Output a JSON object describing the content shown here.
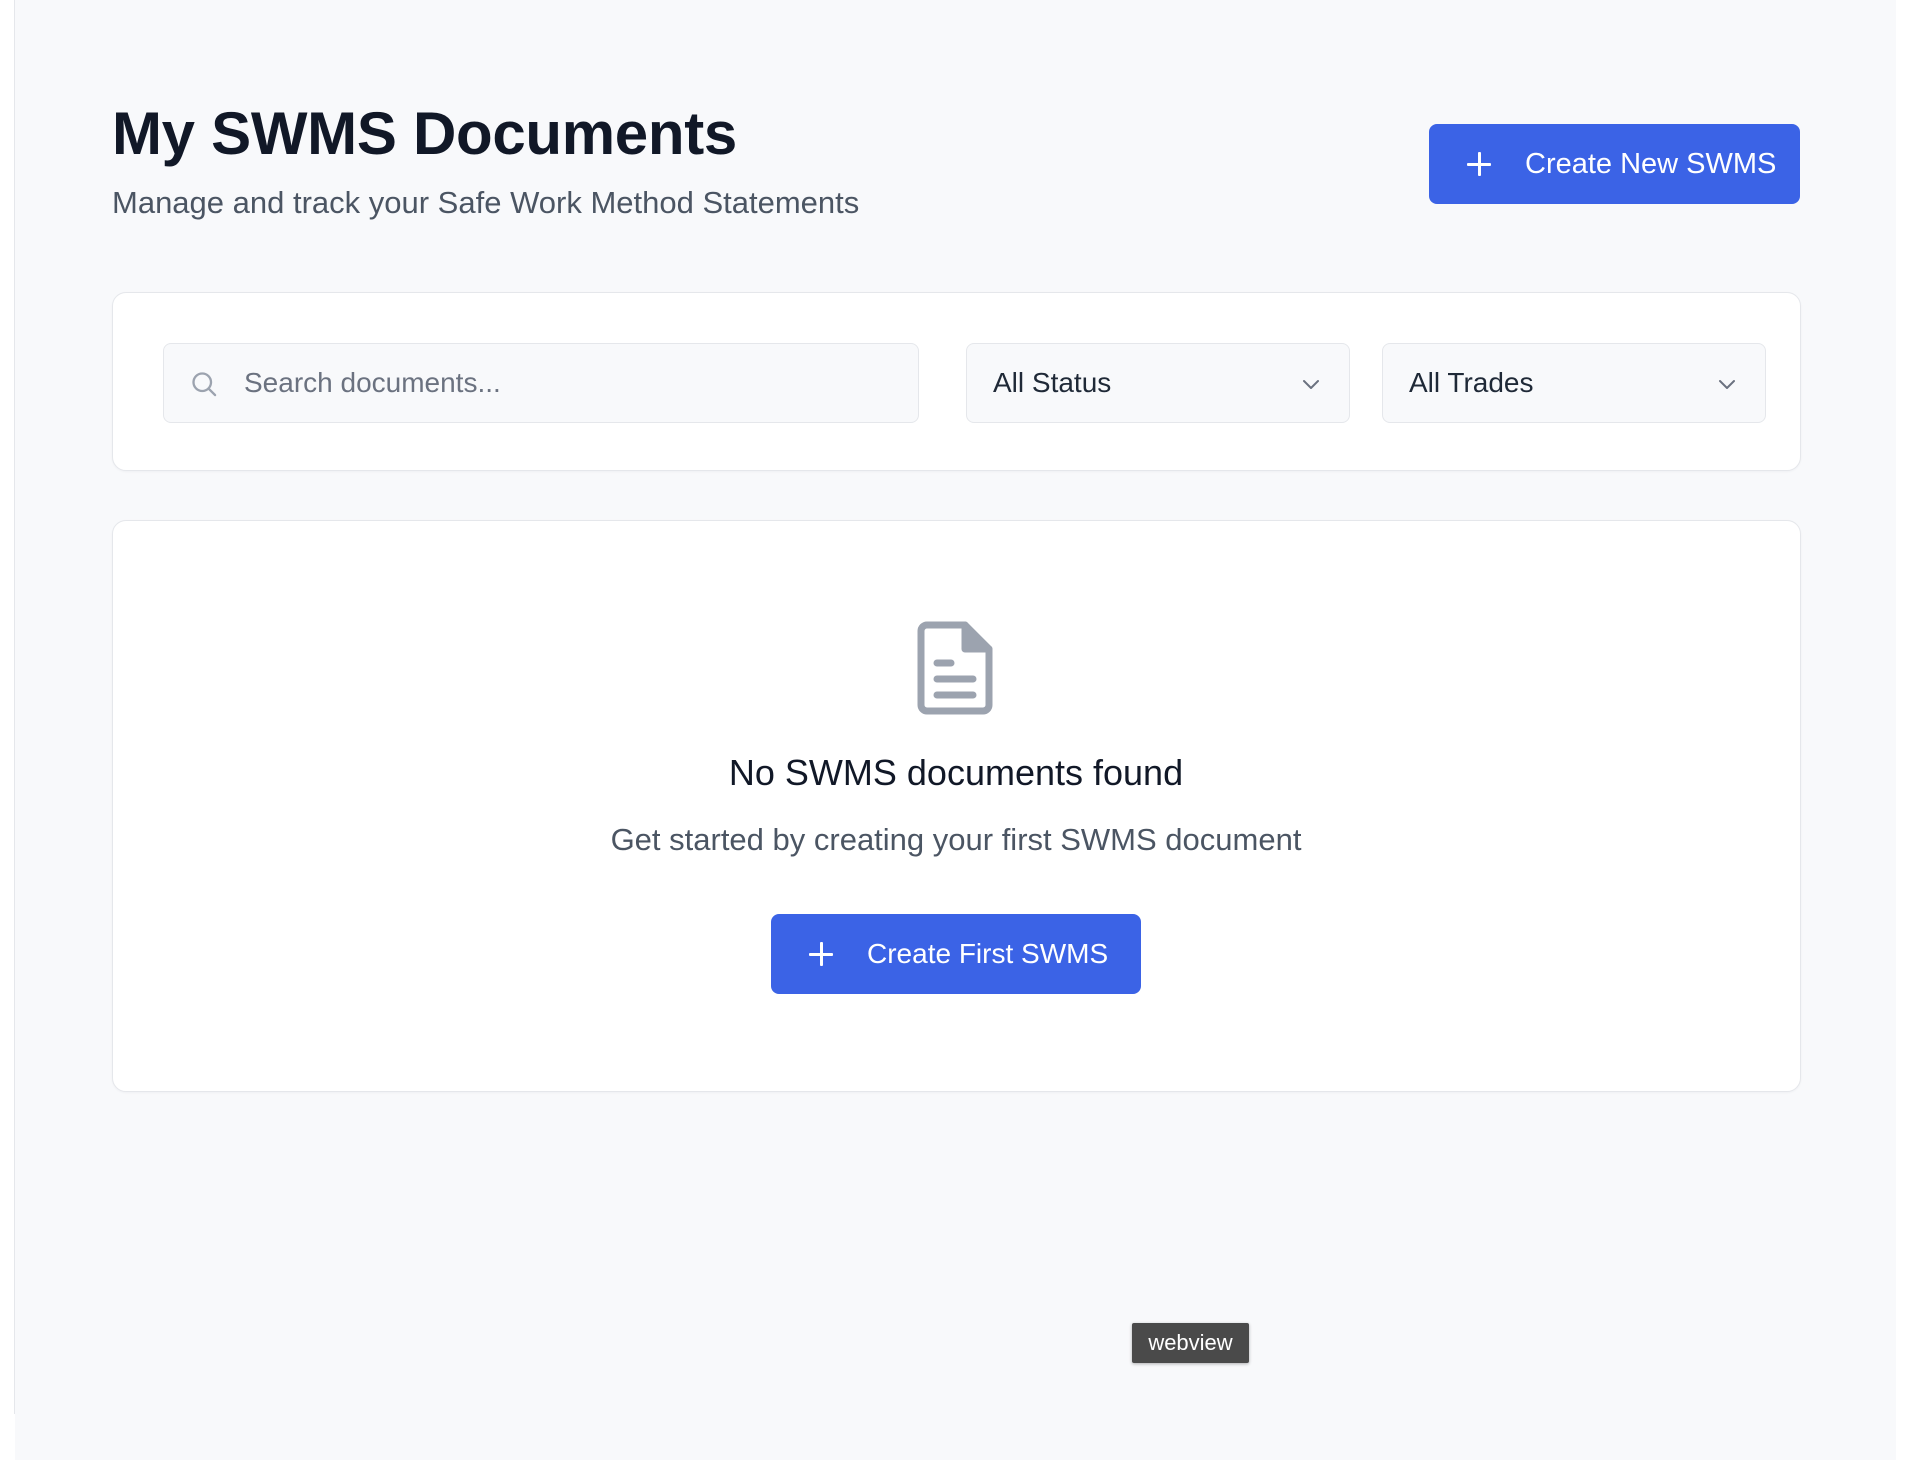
{
  "header": {
    "title": "My SWMS Documents",
    "subtitle": "Manage and track your Safe Work Method Statements",
    "create_button_label": "Create New SWMS"
  },
  "filters": {
    "search": {
      "placeholder": "Search documents...",
      "value": ""
    },
    "status_select": {
      "selected": "All Status"
    },
    "trades_select": {
      "selected": "All Trades"
    }
  },
  "empty_state": {
    "icon": "file-text-icon",
    "title": "No SWMS documents found",
    "message": "Get started by creating your first SWMS document",
    "button_label": "Create First SWMS"
  },
  "tooltip": {
    "label": "webview"
  },
  "colors": {
    "primary": "#3b63e6",
    "page_background": "#f8f9fb",
    "heading": "#111827",
    "muted_text": "#4b5563",
    "border": "#e5e7eb",
    "icon_gray": "#9ca3af"
  }
}
